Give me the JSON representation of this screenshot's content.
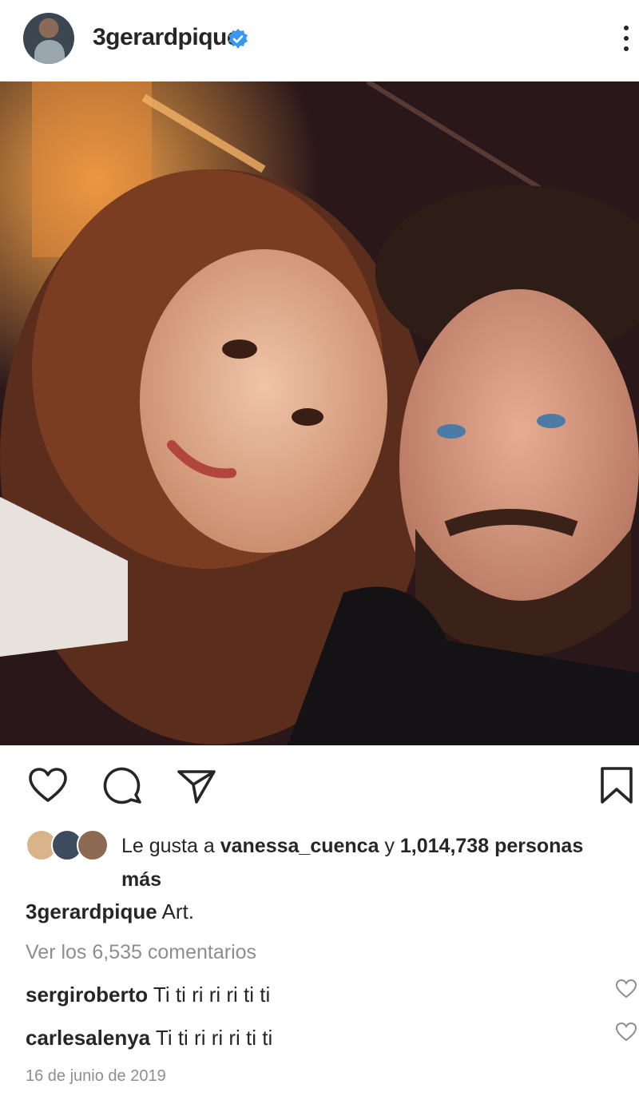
{
  "header": {
    "username": "3gerardpique",
    "avatar_icon": "profile-avatar",
    "verified_icon": "verified-badge-icon",
    "verified_color": "#3897f0",
    "more_icon": "more-options-icon"
  },
  "photo": {
    "description_icon": "post-photo"
  },
  "actions": {
    "like_icon": "heart-icon",
    "comment_icon": "comment-icon",
    "share_icon": "send-icon",
    "save_icon": "bookmark-icon"
  },
  "likes": {
    "prefix": "Le gusta a",
    "user": "vanessa_cuenca",
    "connector": "y",
    "count": "1,014,738",
    "suffix": "personas más"
  },
  "caption": {
    "username": "3gerardpique",
    "text": "Art."
  },
  "view_comments": "Ver los 6,535 comentarios",
  "comments": [
    {
      "username": "sergiroberto",
      "text": "Ti ti ri ri ri ti ti"
    },
    {
      "username": "carlesalenya",
      "text": "Ti ti ri ri ri ti ti"
    }
  ],
  "date": "16 de junio de 2019"
}
